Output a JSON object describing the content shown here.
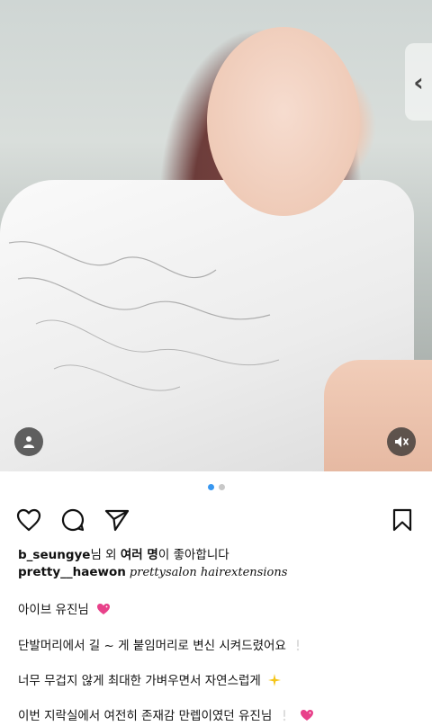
{
  "post": {
    "image_alt_icons": {
      "carousel_next": "chevron-left-icon",
      "tag": "person-icon",
      "mute": "speaker-muted-icon"
    },
    "carousel_next_glyph": "‹",
    "carousel": {
      "count": 2,
      "active_index": 0
    }
  },
  "actions": {
    "like": "heart-icon",
    "comment": "comment-icon",
    "share": "paper-plane-icon",
    "save": "bookmark-icon"
  },
  "likes": {
    "user": "b_seungye",
    "suffix1": "님 외 ",
    "others": "여러 명",
    "suffix2": "이 좋아합니다"
  },
  "caption": {
    "username": "pretty__haewon",
    "tags": "prettysalon hairextensions",
    "lines": [
      "아이브 유진님",
      "단발머리에서 길 ~ 게 붙임머리로 변신 시켜드렸어요",
      "너무 무겁지 않게 최대한 가벼우면서 자연스럽게",
      "이번 지락실에서 여전히 존재감 만렙이였던 유진님"
    ]
  },
  "colors": {
    "active_dot": "#3897f0",
    "inactive_dot": "#c8c8c8",
    "heart_emoji": "#e8418a",
    "sparkle": "#f5c518"
  }
}
